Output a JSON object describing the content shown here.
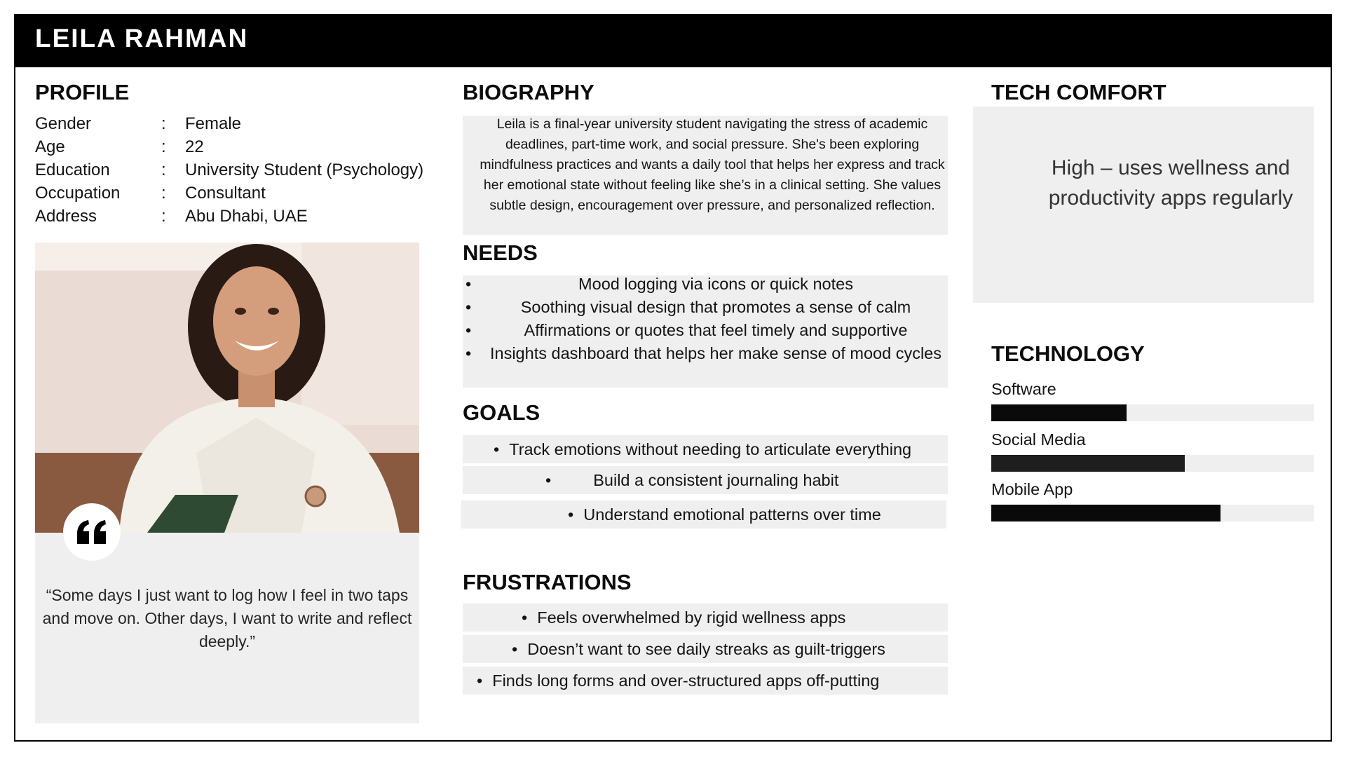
{
  "persona_name": "LEILA RAHMAN",
  "profile": {
    "title": "PROFILE",
    "separator": ":",
    "rows": [
      {
        "label": "Gender",
        "value": "Female"
      },
      {
        "label": "Age",
        "value": "22"
      },
      {
        "label": "Education",
        "value": "University Student (Psychology)"
      },
      {
        "label": "Occupation",
        "value": "Consultant"
      },
      {
        "label": "Address",
        "value": "Abu Dhabi, UAE"
      }
    ]
  },
  "quote": {
    "icon": "quote-icon",
    "text": "“Some days I just want to log how I feel in two taps and move on. Other days, I want to write and reflect deeply.”"
  },
  "biography": {
    "title": "BIOGRAPHY",
    "text": "Leila is a final-year university student navigating the stress of academic deadlines, part-time work, and social pressure. She's been exploring mindfulness practices and wants a daily tool that helps her express and track her emotional state without feeling like she’s in a clinical setting. She values subtle design, encouragement over pressure, and personalized reflection."
  },
  "needs": {
    "title": "NEEDS",
    "items": [
      "Mood logging via icons or quick notes",
      "Soothing visual design that promotes a sense of calm",
      "Affirmations or quotes that feel timely and supportive",
      "Insights dashboard that helps her make sense of mood cycles"
    ]
  },
  "goals": {
    "title": "GOALS",
    "items": [
      "Track emotions without needing to articulate everything",
      "Build a consistent journaling habit",
      "Understand emotional patterns over time"
    ]
  },
  "frustrations": {
    "title": "FRUSTRATIONS",
    "items": [
      "Feels overwhelmed by rigid wellness apps",
      "Doesn’t want to see daily streaks as guilt-triggers",
      "Finds long forms and over-structured apps off-putting"
    ]
  },
  "tech_comfort": {
    "title": "TECH COMFORT",
    "text": "High – uses wellness and productivity apps regularly"
  },
  "technology": {
    "title": "TECHNOLOGY",
    "items": [
      {
        "label": "Software",
        "level": 0.42,
        "color": "#0a0a0a"
      },
      {
        "label": "Social Media",
        "level": 0.6,
        "color": "#1e1e1e"
      },
      {
        "label": "Mobile App",
        "level": 0.71,
        "color": "#0a0a0a"
      }
    ]
  }
}
